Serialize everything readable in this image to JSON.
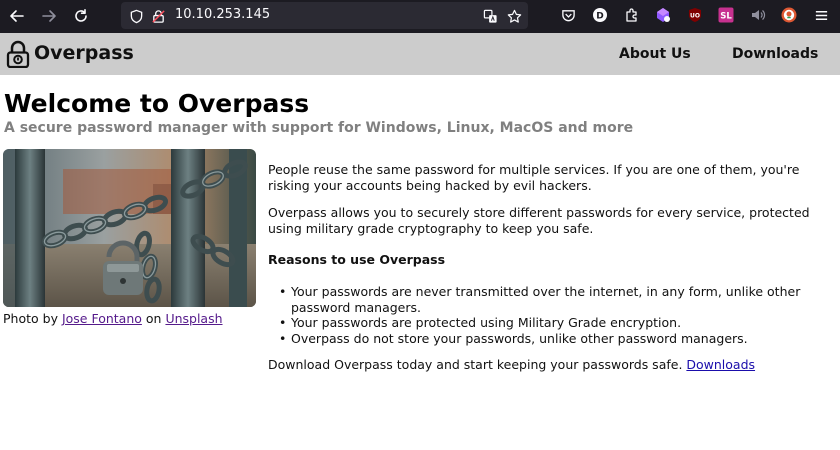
{
  "browser": {
    "url": "10.10.253.145",
    "icons": [
      "back-arrow-icon",
      "forward-arrow-icon",
      "reload-icon",
      "shield-icon",
      "insecure-lock-icon",
      "translate-icon",
      "bookmark-star-icon",
      "pocket-icon",
      "account-icon",
      "extension-icon",
      "extension-purple-icon",
      "ublock-icon",
      "sl-extension-icon",
      "volume-icon",
      "duckduckgo-icon",
      "menu-icon"
    ],
    "extension_badges": {
      "account": "D",
      "ublock": "UO",
      "sl": "SL"
    }
  },
  "site_nav": {
    "brand": "Overpass",
    "links": [
      "About Us",
      "Downloads"
    ]
  },
  "main": {
    "title": "Welcome to Overpass",
    "subtitle": "A secure password manager with support for Windows, Linux, MacOS and more",
    "photo": {
      "caption_prefix": "Photo by ",
      "author": "Jose Fontano",
      "caption_middle": " on ",
      "source": "Unsplash"
    },
    "paragraph1": "People reuse the same password for multiple services. If you are one of them, you're risking your accounts being hacked by evil hackers.",
    "paragraph2": "Overpass allows you to securely store different passwords for every service, protected using military grade cryptography to keep you safe.",
    "reasons_heading": "Reasons to use Overpass",
    "reasons": [
      "Your passwords are never transmitted over the internet, in any form, unlike other password managers.",
      "Your passwords are protected using Military Grade encryption.",
      "Overpass do not store your passwords, unlike other password managers."
    ],
    "cta_text": "Download Overpass today and start keeping your passwords safe. ",
    "cta_link": "Downloads"
  },
  "colors": {
    "browser_bg": "#1c1b22",
    "url_bg": "#2b2a33",
    "nav_bg": "#cccccc",
    "subtitle": "#808080",
    "link": "#1a0dab",
    "visited_link": "#551a8b"
  }
}
